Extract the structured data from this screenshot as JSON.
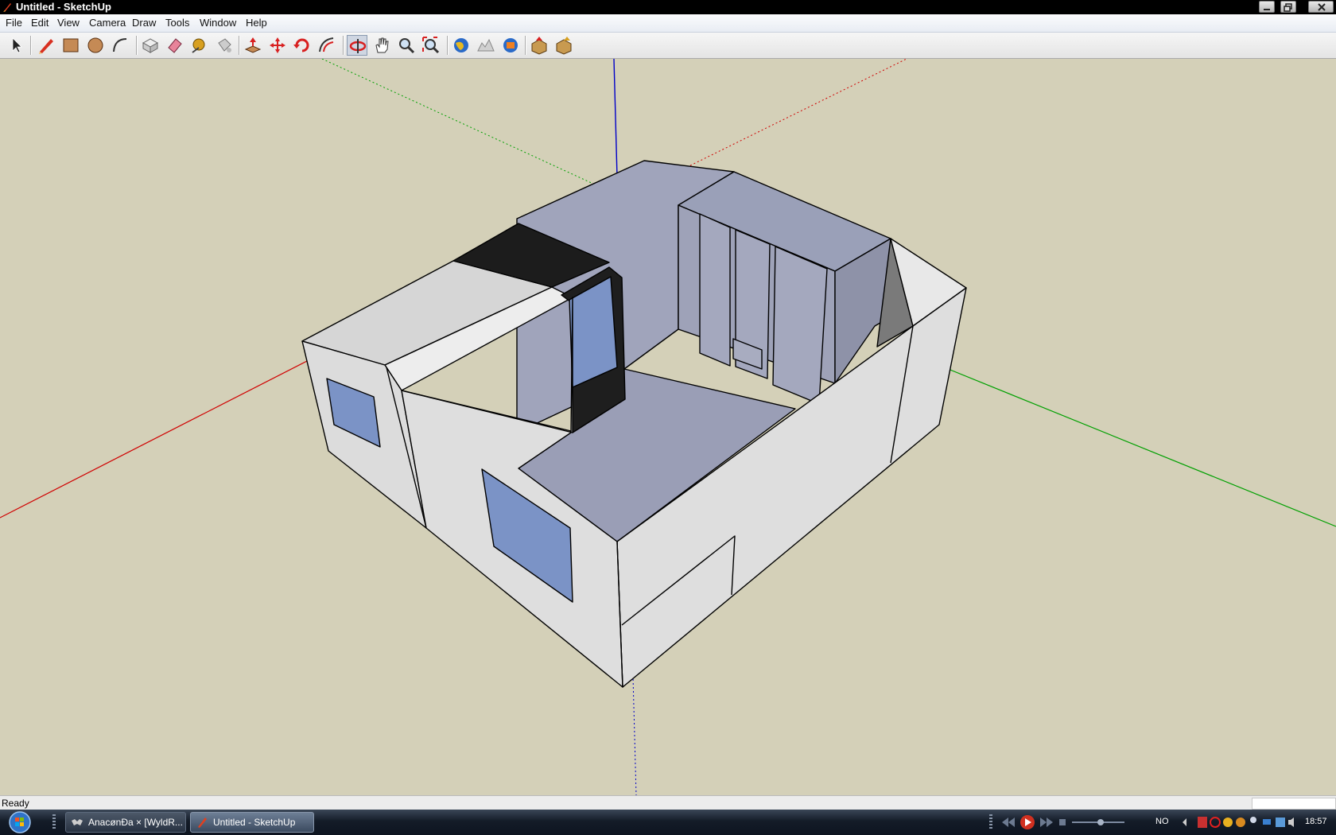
{
  "window": {
    "title": "Untitled - SketchUp"
  },
  "menu": [
    "File",
    "Edit",
    "View",
    "Camera",
    "Draw",
    "Tools",
    "Window",
    "Help"
  ],
  "toolbar": {
    "tools": [
      {
        "name": "select",
        "icon": "arrow-icon"
      },
      {
        "name": "pencil",
        "icon": "pencil-icon"
      },
      {
        "name": "rectangle",
        "icon": "rectangle-icon"
      },
      {
        "name": "circle",
        "icon": "circle-icon"
      },
      {
        "name": "arc",
        "icon": "arc-icon"
      },
      {
        "name": "make-component",
        "icon": "component-icon"
      },
      {
        "name": "eraser",
        "icon": "eraser-icon"
      },
      {
        "name": "tape-measure",
        "icon": "tape-measure-icon"
      },
      {
        "name": "paint-bucket",
        "icon": "paint-bucket-icon"
      },
      {
        "name": "push-pull",
        "icon": "push-pull-icon"
      },
      {
        "name": "move",
        "icon": "move-icon"
      },
      {
        "name": "rotate",
        "icon": "rotate-icon"
      },
      {
        "name": "offset",
        "icon": "offset-icon"
      },
      {
        "name": "orbit",
        "icon": "orbit-icon"
      },
      {
        "name": "pan",
        "icon": "hand-icon"
      },
      {
        "name": "zoom",
        "icon": "magnifier-icon"
      },
      {
        "name": "zoom-extents",
        "icon": "zoom-extents-icon"
      },
      {
        "name": "get-current-view",
        "icon": "earth-icon"
      },
      {
        "name": "toggle-terrain",
        "icon": "terrain-icon"
      },
      {
        "name": "place-model",
        "icon": "place-model-icon"
      },
      {
        "name": "get-models",
        "icon": "get-models-icon"
      },
      {
        "name": "share-model",
        "icon": "share-model-icon"
      }
    ]
  },
  "status": {
    "text": "Ready"
  },
  "taskbar": {
    "buttons": [
      {
        "label": "AnacønÐa × [WyldR...",
        "icon": "bat-icon",
        "active": false
      },
      {
        "label": "Untitled - SketchUp",
        "icon": "sketchup-icon",
        "active": true
      }
    ],
    "language": "NO",
    "clock": "18:57"
  },
  "colors": {
    "viewport_bg": "#d4d0b8",
    "face_front": "#dcdcdc",
    "face_back": "#a2a6bd",
    "glass": "#7b93c6",
    "axis_red": "#d00000",
    "axis_green": "#00a000",
    "axis_blue": "#0000c8"
  }
}
